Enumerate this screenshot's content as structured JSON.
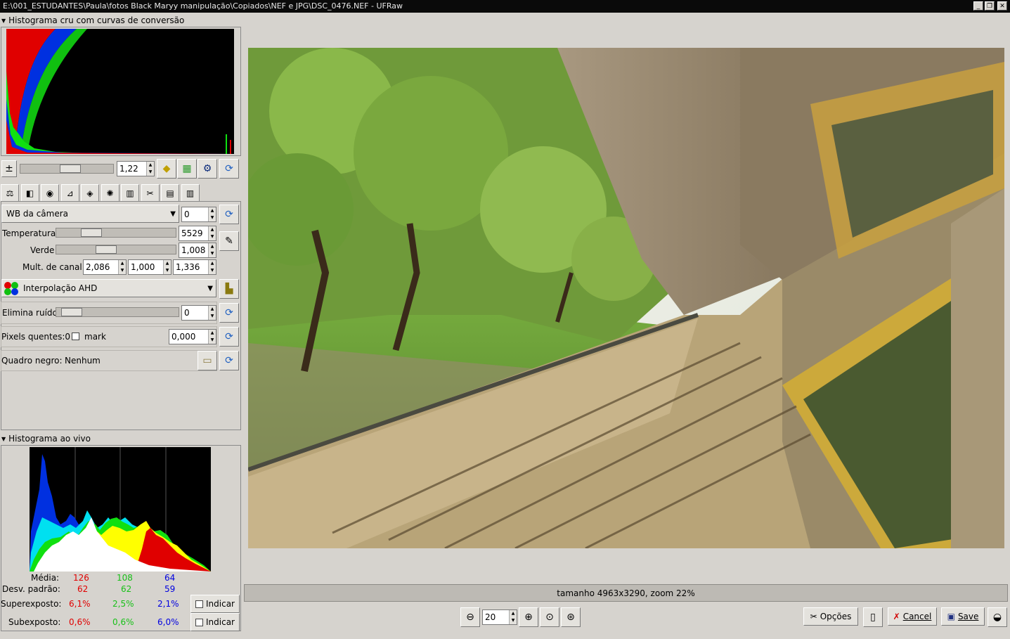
{
  "window": {
    "title": "E:\\001_ESTUDANTES\\Paula\\fotos Black Maryy manipulação\\Copiados\\NEF e JPG\\DSC_0476.NEF - UFRaw",
    "minimize": "_",
    "maximize": "❐",
    "close": "✕"
  },
  "raw_histogram": {
    "title": "Histograma cru com curvas de conversão"
  },
  "exposure": {
    "value": "1,22",
    "slider_fraction": 0.55
  },
  "tabs": [
    "wb",
    "grayscale",
    "lens",
    "base-curve",
    "color-mgmt",
    "corrections",
    "color-curve",
    "crop",
    "save",
    "exif"
  ],
  "white_balance": {
    "preset": "WB da câmera",
    "fine_tune": "0",
    "temperature_label": "Temperatura",
    "temperature": "5529",
    "temperature_fraction": 0.25,
    "green_label": "Verde",
    "green": "1,008",
    "green_fraction": 0.4,
    "channel_label": "Mult. de canal:",
    "channel_r": "2,086",
    "channel_g": "1,000",
    "channel_b": "1,336"
  },
  "interpolation": {
    "value": "Interpolação AHD"
  },
  "denoise": {
    "label": "Elimina ruído",
    "value": "0",
    "slider_fraction": 0.05
  },
  "hot_pixels": {
    "label": "Pixels quentes:0",
    "mark_label": "mark",
    "value": "0,000"
  },
  "dark_frame": {
    "label": "Quadro negro:",
    "value": "Nenhum"
  },
  "live_histogram": {
    "title": "Histograma ao vivo",
    "mean_label": "Média:",
    "mean": [
      "126",
      "108",
      "64"
    ],
    "stddev_label": "Desv. padrão:",
    "stddev": [
      "62",
      "62",
      "59"
    ],
    "over_label": "Superexposto:",
    "over": [
      "6,1%",
      "2,5%",
      "2,1%"
    ],
    "under_label": "Subexposto:",
    "under": [
      "0,6%",
      "0,6%",
      "6,0%"
    ],
    "indicate_label": "Indicar"
  },
  "status": {
    "text": "tamanho 4963x3290, zoom 22%"
  },
  "zoom": {
    "value": "20"
  },
  "buttons": {
    "options": "Opções",
    "cancel": "Cancel",
    "save": "Save"
  },
  "colors": {
    "bg": "#d6d3ce",
    "red": "#e00000",
    "green": "#18c018",
    "blue": "#0000e0"
  }
}
